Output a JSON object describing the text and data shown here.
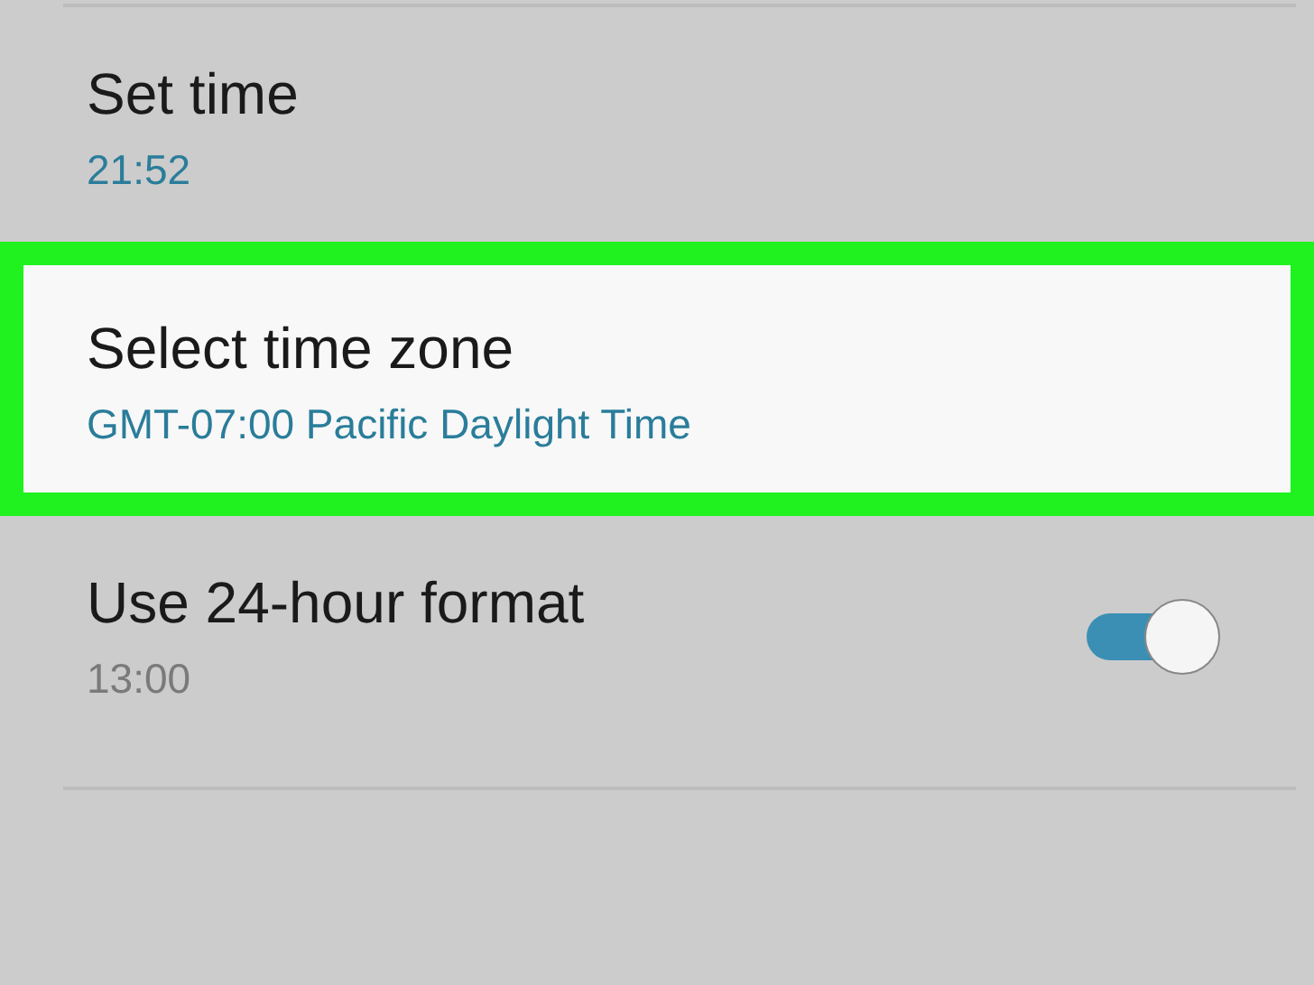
{
  "settings": [
    {
      "kind": "plain",
      "title": "Set time",
      "value": "21:52",
      "highlighted": false
    },
    {
      "kind": "plain",
      "title": "Select time zone",
      "value": "GMT-07:00 Pacific Daylight Time",
      "highlighted": true
    },
    {
      "kind": "toggle",
      "title": "Use 24-hour format",
      "value": "13:00",
      "highlighted": false,
      "on": true
    }
  ]
}
